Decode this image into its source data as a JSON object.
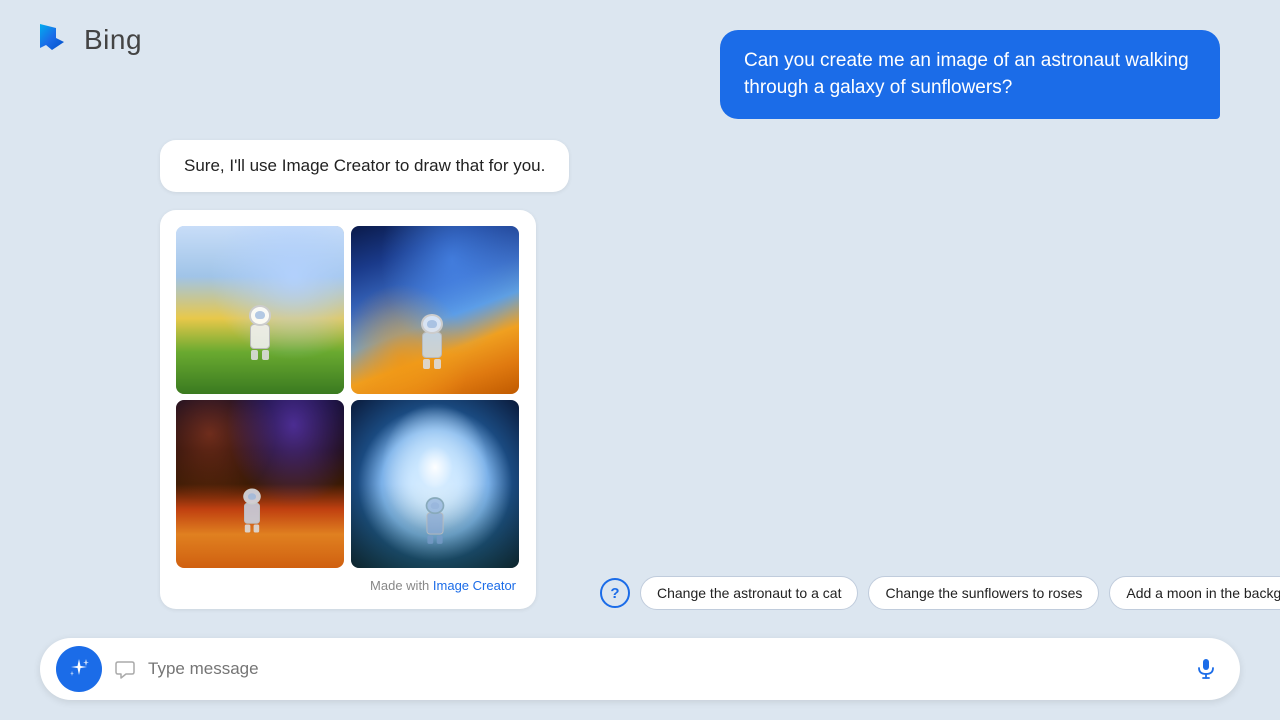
{
  "header": {
    "logo_text": "Bing"
  },
  "user_bubble": {
    "text": "Can you create me an image of an astronaut walking through a galaxy of sunflowers?"
  },
  "bot_message": {
    "text": "Sure, I'll use Image Creator to draw that for you."
  },
  "image_grid": {
    "made_with_text": "Made with",
    "made_with_link": "Image Creator"
  },
  "suggestions": {
    "help_label": "?",
    "chip1": "Change the astronaut to a cat",
    "chip2": "Change the sunflowers to roses",
    "chip3": "Add a moon in the background"
  },
  "input_bar": {
    "placeholder": "Type message"
  },
  "colors": {
    "accent": "#1b6ce8",
    "background": "#dce6f0",
    "white": "#ffffff",
    "chip_border": "#c0ccdc"
  }
}
